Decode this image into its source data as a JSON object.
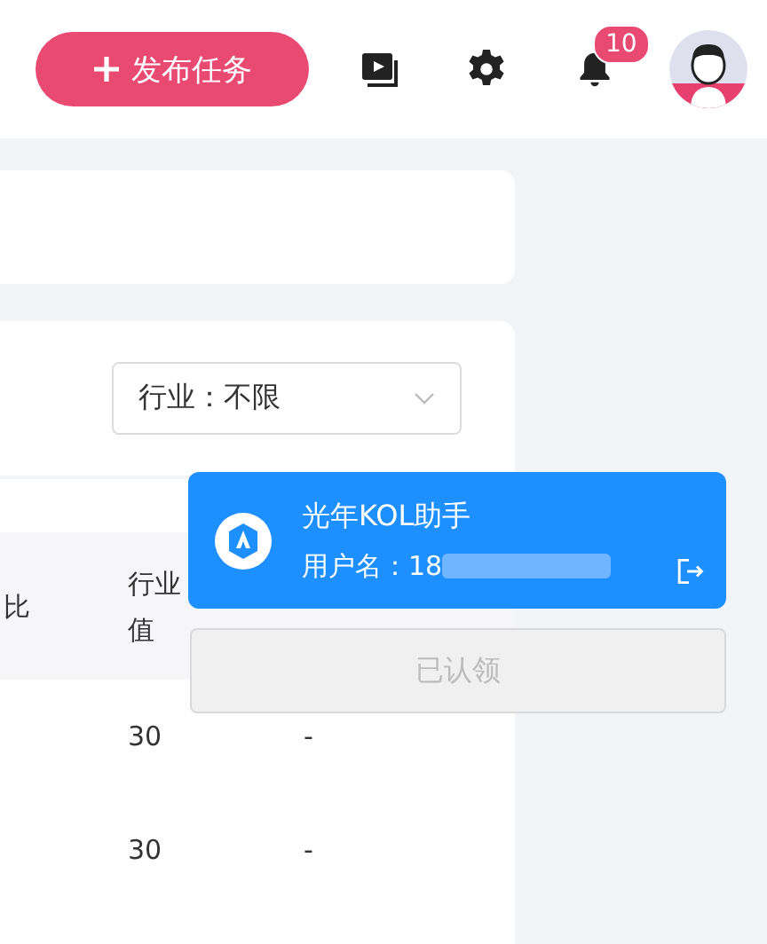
{
  "header": {
    "publish_button": "发布任务",
    "notifications": {
      "badge": "10"
    }
  },
  "filter": {
    "label": "行业：不限"
  },
  "table": {
    "columns": [
      {
        "lines": [
          "比"
        ]
      },
      {
        "lines": [
          "行业",
          "值"
        ]
      }
    ],
    "rows": [
      {
        "column_2": "30",
        "column_3": "-"
      },
      {
        "column_2": "30",
        "column_3": "-"
      }
    ]
  },
  "account_popup": {
    "title": "光年KOL助手",
    "username_label": "用户名：18"
  },
  "claim_button": {
    "label": "已认领",
    "disabled": true
  }
}
